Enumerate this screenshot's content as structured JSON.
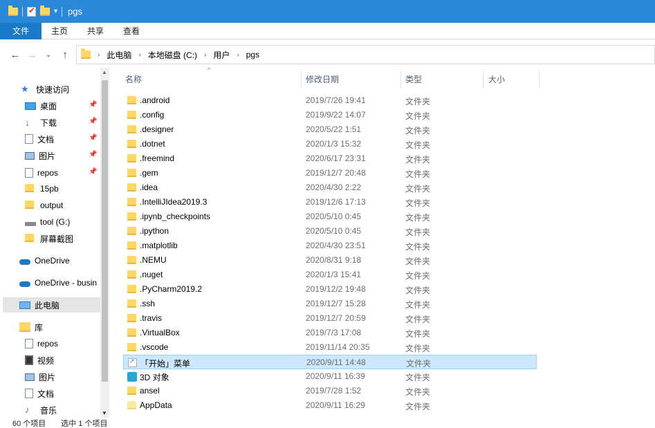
{
  "window": {
    "title": "pgs"
  },
  "ribbon": {
    "tabs": [
      "文件",
      "主页",
      "共享",
      "查看"
    ]
  },
  "address": {
    "crumbs": [
      "此电脑",
      "本地磁盘 (C:)",
      "用户",
      "pgs"
    ]
  },
  "sidebar": {
    "items": [
      {
        "label": "快速访问",
        "icon": "star-icon",
        "pinned": false
      },
      {
        "label": "桌面",
        "icon": "desktop-icon",
        "pinned": true
      },
      {
        "label": "下载",
        "icon": "download-icon",
        "pinned": true
      },
      {
        "label": "文档",
        "icon": "document-icon",
        "pinned": true
      },
      {
        "label": "图片",
        "icon": "pictures-icon",
        "pinned": true
      },
      {
        "label": "repos",
        "icon": "document-icon",
        "pinned": true
      },
      {
        "label": "15pb",
        "icon": "folder-icon",
        "pinned": false
      },
      {
        "label": "output",
        "icon": "folder-icon",
        "pinned": false
      },
      {
        "label": "tool (G:)",
        "icon": "drive-icon",
        "pinned": false
      },
      {
        "label": "屏幕截图",
        "icon": "folder-icon",
        "pinned": false
      },
      {
        "label": "OneDrive",
        "icon": "onedrive-icon",
        "pinned": false
      },
      {
        "label": "OneDrive - busin",
        "icon": "onedrive-icon",
        "pinned": false
      },
      {
        "label": "此电脑",
        "icon": "this-pc-icon",
        "pinned": false,
        "selected": true
      },
      {
        "label": "库",
        "icon": "library-icon",
        "pinned": false
      },
      {
        "label": "repos",
        "icon": "document-icon",
        "pinned": false
      },
      {
        "label": "视频",
        "icon": "video-icon",
        "pinned": false
      },
      {
        "label": "图片",
        "icon": "pictures-icon",
        "pinned": false
      },
      {
        "label": "文档",
        "icon": "document-icon",
        "pinned": false
      },
      {
        "label": "音乐",
        "icon": "music-icon",
        "pinned": false
      }
    ]
  },
  "columns": {
    "name": "名称",
    "date": "修改日期",
    "type": "类型",
    "size": "大小"
  },
  "files": [
    {
      "name": ".android",
      "date": "2019/7/26 19:41",
      "type": "文件夹",
      "icon": "folder"
    },
    {
      "name": ".config",
      "date": "2019/9/22 14:07",
      "type": "文件夹",
      "icon": "folder"
    },
    {
      "name": ".designer",
      "date": "2020/5/22 1:51",
      "type": "文件夹",
      "icon": "folder"
    },
    {
      "name": ".dotnet",
      "date": "2020/1/3 15:32",
      "type": "文件夹",
      "icon": "folder"
    },
    {
      "name": ".freemind",
      "date": "2020/6/17 23:31",
      "type": "文件夹",
      "icon": "folder"
    },
    {
      "name": ".gem",
      "date": "2019/12/7 20:48",
      "type": "文件夹",
      "icon": "folder"
    },
    {
      "name": ".idea",
      "date": "2020/4/30 2:22",
      "type": "文件夹",
      "icon": "folder"
    },
    {
      "name": ".IntelliJIdea2019.3",
      "date": "2019/12/6 17:13",
      "type": "文件夹",
      "icon": "folder"
    },
    {
      "name": ".ipynb_checkpoints",
      "date": "2020/5/10 0:45",
      "type": "文件夹",
      "icon": "folder"
    },
    {
      "name": ".ipython",
      "date": "2020/5/10 0:45",
      "type": "文件夹",
      "icon": "folder"
    },
    {
      "name": ".matplotlib",
      "date": "2020/4/30 23:51",
      "type": "文件夹",
      "icon": "folder"
    },
    {
      "name": ".NEMU",
      "date": "2020/8/31 9:18",
      "type": "文件夹",
      "icon": "folder"
    },
    {
      "name": ".nuget",
      "date": "2020/1/3 15:41",
      "type": "文件夹",
      "icon": "folder"
    },
    {
      "name": ".PyCharm2019.2",
      "date": "2019/12/2 19:48",
      "type": "文件夹",
      "icon": "folder"
    },
    {
      "name": ".ssh",
      "date": "2019/12/7 15:28",
      "type": "文件夹",
      "icon": "folder"
    },
    {
      "name": ".travis",
      "date": "2019/12/7 20:59",
      "type": "文件夹",
      "icon": "folder"
    },
    {
      "name": ".VirtualBox",
      "date": "2019/7/3 17:08",
      "type": "文件夹",
      "icon": "folder"
    },
    {
      "name": ".vscode",
      "date": "2019/11/14 20:35",
      "type": "文件夹",
      "icon": "folder"
    },
    {
      "name": "「开始」菜单",
      "date": "2020/9/11 14:48",
      "type": "文件夹",
      "icon": "shortcut",
      "selected": true
    },
    {
      "name": "3D 对象",
      "date": "2020/9/11 16:39",
      "type": "文件夹",
      "icon": "3d"
    },
    {
      "name": "ansel",
      "date": "2019/7/28 1:52",
      "type": "文件夹",
      "icon": "folder"
    },
    {
      "name": "AppData",
      "date": "2020/9/11 16:29",
      "type": "文件夹",
      "icon": "light"
    }
  ],
  "status": {
    "item_count": "60 个项目",
    "selected": "选中 1 个项目"
  }
}
